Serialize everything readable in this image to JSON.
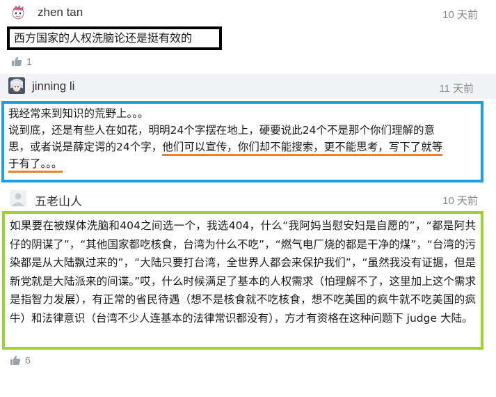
{
  "comments": [
    {
      "author": "zhen tan",
      "time": "10 天前",
      "text": "西方国家的人权洗脑论还是挺有效的",
      "likes": "1",
      "box_color": "#000000"
    },
    {
      "author": "jinning li",
      "time": "11 天前",
      "lines": {
        "l1": "我经常来到知识的荒野上。。。",
        "l2": "说到底，还是有些人在如花，明明24个字摆在地上，硬要说此24个不是那个你们理解的意",
        "l3a": "思，或者说是薛定谔的24个字，",
        "l3b": "他们可以宣传，你们却不能搜索，更不能思考，写下了就等",
        "l4": "于有了。。。"
      },
      "box_color": "#1aa0e0",
      "underline_color": "#f0802a"
    },
    {
      "author": "五老山人",
      "time": "10 天前",
      "text": "如果要在被媒体洗脑和404之间选一个，我选404，什么“我阿妈当慰安妇是自愿的”，“都是阿共仔的阴谋了”，“其他国家都吃核食，台湾为什么不吃”，“燃气电厂烧的都是干净的煤”，“台湾的污染都是从大陆飘过来的”，“大陆只要打台湾，全世界人都会来保护我们”，“虽然我没有证据，但是新党就是大陆派来的间谍。”哎，什么时候满足了基本的人权需求（怕理解不了，这里加上这个需求是指智力发展），有正常的省民待遇（想不是核食就不吃核食，想不吃美国的疯牛就不吃美国的疯牛）和法律意识（台湾不少人连基本的法律常识都没有），方才有资格在这种问题下 judge 大陆。",
      "likes": "6",
      "box_color": "#9fd22a"
    }
  ],
  "icons": {
    "like": "thumbs-up-icon"
  }
}
